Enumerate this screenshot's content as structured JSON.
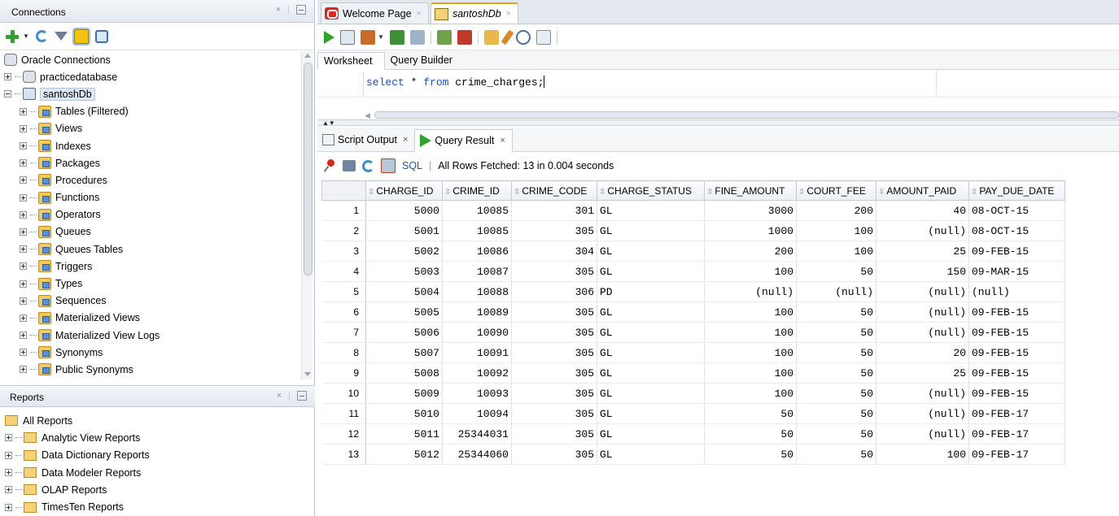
{
  "connections_panel": {
    "title": "Connections",
    "tree": [
      {
        "label": "Oracle Connections",
        "level": 0,
        "expander": "none",
        "icon": "db-icon"
      },
      {
        "label": "practicedatabase",
        "level": 1,
        "expander": "plus",
        "icon": "db-icon"
      },
      {
        "label": "santoshDb",
        "level": 1,
        "expander": "minus",
        "icon": "connection-icon",
        "selected": true
      },
      {
        "label": "Tables (Filtered)",
        "level": 2,
        "expander": "plus",
        "icon": "tables-icon"
      },
      {
        "label": "Views",
        "level": 2,
        "expander": "plus",
        "icon": "views-icon"
      },
      {
        "label": "Indexes",
        "level": 2,
        "expander": "plus",
        "icon": "indexes-icon"
      },
      {
        "label": "Packages",
        "level": 2,
        "expander": "plus",
        "icon": "packages-icon"
      },
      {
        "label": "Procedures",
        "level": 2,
        "expander": "plus",
        "icon": "procedures-icon"
      },
      {
        "label": "Functions",
        "level": 2,
        "expander": "plus",
        "icon": "functions-icon"
      },
      {
        "label": "Operators",
        "level": 2,
        "expander": "plus",
        "icon": "operators-icon"
      },
      {
        "label": "Queues",
        "level": 2,
        "expander": "plus",
        "icon": "queues-icon"
      },
      {
        "label": "Queues Tables",
        "level": 2,
        "expander": "plus",
        "icon": "queues-tables-icon"
      },
      {
        "label": "Triggers",
        "level": 2,
        "expander": "plus",
        "icon": "triggers-icon"
      },
      {
        "label": "Types",
        "level": 2,
        "expander": "plus",
        "icon": "types-icon"
      },
      {
        "label": "Sequences",
        "level": 2,
        "expander": "plus",
        "icon": "sequences-icon"
      },
      {
        "label": "Materialized Views",
        "level": 2,
        "expander": "plus",
        "icon": "materialized-views-icon"
      },
      {
        "label": "Materialized View Logs",
        "level": 2,
        "expander": "plus",
        "icon": "materialized-view-logs-icon"
      },
      {
        "label": "Synonyms",
        "level": 2,
        "expander": "plus",
        "icon": "synonyms-icon"
      },
      {
        "label": "Public Synonyms",
        "level": 2,
        "expander": "plus",
        "icon": "public-synonyms-icon"
      }
    ]
  },
  "reports_panel": {
    "title": "Reports",
    "items": [
      {
        "label": "All Reports",
        "root": true
      },
      {
        "label": "Analytic View Reports"
      },
      {
        "label": "Data Dictionary Reports"
      },
      {
        "label": "Data Modeler Reports"
      },
      {
        "label": "OLAP Reports"
      },
      {
        "label": "TimesTen Reports"
      }
    ]
  },
  "doc_tabs": [
    {
      "label": "Welcome Page",
      "icon": "oracle-icon",
      "active": false
    },
    {
      "label": "santoshDb",
      "icon": "sql-worksheet-icon",
      "active": true
    }
  ],
  "worksheet_tabs": [
    "Worksheet",
    "Query Builder"
  ],
  "editor": {
    "keyword_select": "select",
    "rest_1": " * ",
    "keyword_from": "from",
    "rest_2": " crime_charges;"
  },
  "output_tabs": [
    {
      "label": "Script Output",
      "close": "×"
    },
    {
      "label": "Query Result",
      "close": "×"
    }
  ],
  "result_toolbar": {
    "sql_label": "SQL",
    "separator": "|",
    "status": "All Rows Fetched: 13 in 0.004 seconds"
  },
  "result_grid": {
    "columns": [
      "CHARGE_ID",
      "CRIME_ID",
      "CRIME_CODE",
      "CHARGE_STATUS",
      "FINE_AMOUNT",
      "COURT_FEE",
      "AMOUNT_PAID",
      "PAY_DUE_DATE"
    ],
    "rows": [
      [
        "1",
        "5000",
        "10085",
        "301",
        "GL",
        "3000",
        "200",
        "40",
        "08-OCT-15"
      ],
      [
        "2",
        "5001",
        "10085",
        "305",
        "GL",
        "1000",
        "100",
        "(null)",
        "08-OCT-15"
      ],
      [
        "3",
        "5002",
        "10086",
        "304",
        "GL",
        "200",
        "100",
        "25",
        "09-FEB-15"
      ],
      [
        "4",
        "5003",
        "10087",
        "305",
        "GL",
        "100",
        "50",
        "150",
        "09-MAR-15"
      ],
      [
        "5",
        "5004",
        "10088",
        "306",
        "PD",
        "(null)",
        "(null)",
        "(null)",
        "(null)"
      ],
      [
        "6",
        "5005",
        "10089",
        "305",
        "GL",
        "100",
        "50",
        "(null)",
        "09-FEB-15"
      ],
      [
        "7",
        "5006",
        "10090",
        "305",
        "GL",
        "100",
        "50",
        "(null)",
        "09-FEB-15"
      ],
      [
        "8",
        "5007",
        "10091",
        "305",
        "GL",
        "100",
        "50",
        "20",
        "09-FEB-15"
      ],
      [
        "9",
        "5008",
        "10092",
        "305",
        "GL",
        "100",
        "50",
        "25",
        "09-FEB-15"
      ],
      [
        "10",
        "5009",
        "10093",
        "305",
        "GL",
        "100",
        "50",
        "(null)",
        "09-FEB-15"
      ],
      [
        "11",
        "5010",
        "10094",
        "305",
        "GL",
        "50",
        "50",
        "(null)",
        "09-FEB-17"
      ],
      [
        "12",
        "5011",
        "25344031",
        "305",
        "GL",
        "50",
        "50",
        "(null)",
        "09-FEB-17"
      ],
      [
        "13",
        "5012",
        "25344060",
        "305",
        "GL",
        "50",
        "50",
        "100",
        "09-FEB-17"
      ]
    ]
  }
}
